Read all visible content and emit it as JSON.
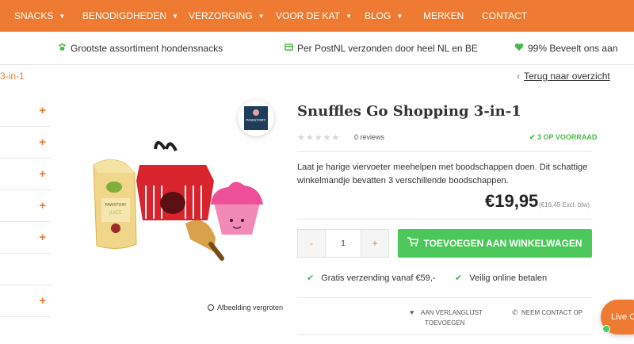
{
  "nav": {
    "items": [
      {
        "label": "SNACKS",
        "dropdown": true
      },
      {
        "label": "BENODIGDHEDEN",
        "dropdown": true
      },
      {
        "label": "VERZORGING",
        "dropdown": true
      },
      {
        "label": "VOOR DE KAT",
        "dropdown": true
      },
      {
        "label": "BLOG",
        "dropdown": true
      },
      {
        "label": "MERKEN",
        "dropdown": false
      },
      {
        "label": "CONTACT",
        "dropdown": false
      }
    ]
  },
  "usp": [
    {
      "icon": "paw-icon",
      "text": "Grootste assortiment hondensnacks"
    },
    {
      "icon": "package-icon",
      "text": "Per PostNL verzonden door heel NL en BE"
    },
    {
      "icon": "heart-icon",
      "text": "99% Beveelt ons aan"
    }
  ],
  "breadcrumb": "3-in-1",
  "back_link": "Terug naar overzicht",
  "brand": {
    "logo_text": "PAWSTORY"
  },
  "product": {
    "title": "Snuffles Go Shopping 3-in-1",
    "rating": 0,
    "reviews": "0 reviews",
    "stock": "3 OP VOORRAAD",
    "description": "Laat je harige viervoeter meehelpen met boodschappen doen. Dit schattige winkelmandje bevatten 3 verschillende boodschappen.",
    "price": "€19,95",
    "price_excl": "(€16,49 Excl. btw)",
    "quantity": "1",
    "add_to_cart": "TOEVOEGEN AAN WINKELWAGEN",
    "zoom": "Afbeelding vergroten",
    "image_labels": {
      "juice": "PAWSTORY",
      "juice2": "JUICE"
    }
  },
  "perks": [
    "Gratis verzending vanaf €59,-",
    "Veilig online betalen"
  ],
  "actions": {
    "wishlist_line1": "AAN VERLANGLIJST",
    "wishlist_line2": "TOEVOEGEN",
    "contact": "NEEM CONTACT OP"
  },
  "chat": {
    "label": "Live C"
  },
  "colors": {
    "accent": "#ee7b31",
    "success": "#4cc75a"
  }
}
